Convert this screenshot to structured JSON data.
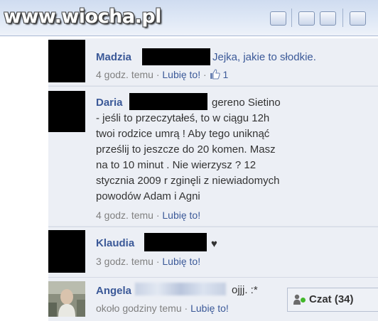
{
  "watermark": "www.wiocha.pl",
  "comments": [
    {
      "author": "Madzia",
      "text": "Jejka, jakie to słodkie.",
      "time": "4 godz. temu",
      "like": "Lubię to!",
      "likes": "1"
    },
    {
      "author": "Daria",
      "text_lines": [
        "gereno Sietino",
        "- jeśli to przeczytałeś, to w ciągu 12h",
        "twoi rodzice umrą ! Aby tego uniknąć",
        "prześlij to jeszcze do 20 komen. Masz",
        "na to 10 minut . Nie wierzysz ? 12",
        "stycznia 2009 r zginęli z niewiadomych",
        "powodów Adam i Agni"
      ],
      "time": "4 godz. temu",
      "like": "Lubię to!"
    },
    {
      "author": "Klaudia",
      "text": "♥",
      "time": "3 godz. temu",
      "like": "Lubię to!"
    },
    {
      "author": "Angela",
      "text": "ojjj. :*",
      "time": "około godziny temu",
      "like": "Lubię to!"
    }
  ],
  "separator": "·",
  "chat": {
    "label": "Czat",
    "count": "(34)"
  },
  "colors": {
    "link": "#3b5998",
    "comment_bg": "#eceff5",
    "text": "#333333",
    "meta": "#808080"
  },
  "icons": [
    "thumbs-up-icon",
    "friends-icon",
    "online-dot-icon"
  ]
}
